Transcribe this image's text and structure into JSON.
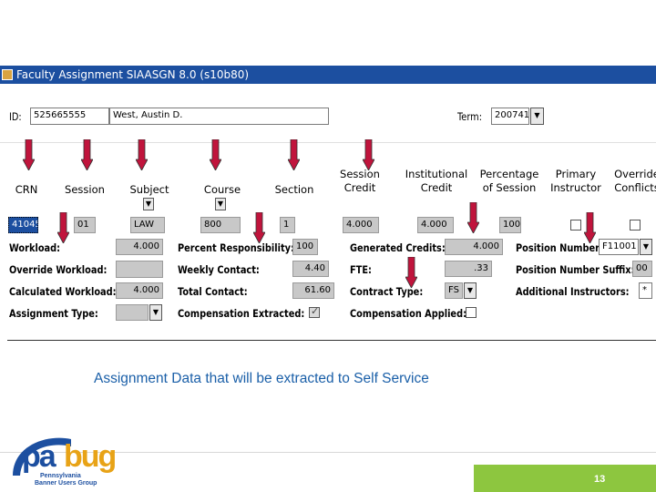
{
  "window": {
    "title": "Faculty Assignment  SIAASGN  8.0  (s10b80)"
  },
  "key_block": {
    "id_label": "ID:",
    "id_value": "525665555",
    "name_value": "West, Austin D.",
    "term_label": "Term:",
    "term_value": "200741"
  },
  "columns": {
    "crn": "CRN",
    "session": "Session",
    "subject": "Subject",
    "course": "Course",
    "section": "Section",
    "session_credit": [
      "Session",
      "Credit"
    ],
    "institutional_credit": [
      "Institutional",
      "Credit"
    ],
    "percentage_session": [
      "Percentage",
      "of Session"
    ],
    "primary_instructor": [
      "Primary",
      "Instructor"
    ],
    "override_conflicts": [
      "Override",
      "Conflicts"
    ]
  },
  "row": {
    "crn": "41045",
    "session": "01",
    "subject": "LAW",
    "course": "800",
    "section": "1",
    "session_credit": "4.000",
    "institutional_credit": "4.000",
    "percentage_session": "100"
  },
  "details": {
    "workload_label": "Workload:",
    "workload_value": "4.000",
    "override_workload_label": "Override Workload:",
    "override_workload_value": "",
    "calculated_workload_label": "Calculated Workload:",
    "calculated_workload_value": "4.000",
    "assignment_type_label": "Assignment Type:",
    "assignment_type_value": "",
    "percent_responsibility_label": "Percent Responsibility:",
    "percent_responsibility_value": "100",
    "weekly_contact_label": "Weekly Contact:",
    "weekly_contact_value": "4.40",
    "total_contact_label": "Total Contact:",
    "total_contact_value": "61.60",
    "compensation_extracted_label": "Compensation Extracted:",
    "generated_credits_label": "Generated Credits:",
    "generated_credits_value": "4.000",
    "fte_label": "FTE:",
    "fte_value": ".33",
    "contract_type_label": "Contract Type:",
    "contract_type_value": "FS",
    "compensation_applied_label": "Compensation Applied:",
    "position_number_label": "Position Number:",
    "position_number_value": "F11001",
    "position_suffix_label": "Position Number Suffix:",
    "position_suffix_value": "00",
    "additional_instructors_label": "Additional Instructors:",
    "additional_instructors_value": "*"
  },
  "caption": "Assignment Data that will be extracted to Self Service",
  "footer": {
    "page_number": "13",
    "logo_main": "pabug",
    "logo_sub_1": "Pennsylvania",
    "logo_sub_2": "Banner Users Group"
  },
  "colors": {
    "title_bar": "#1c4fa0",
    "arrow": "#c0143c",
    "caption": "#1a5fa8",
    "footer_bar": "#8dc63f"
  }
}
